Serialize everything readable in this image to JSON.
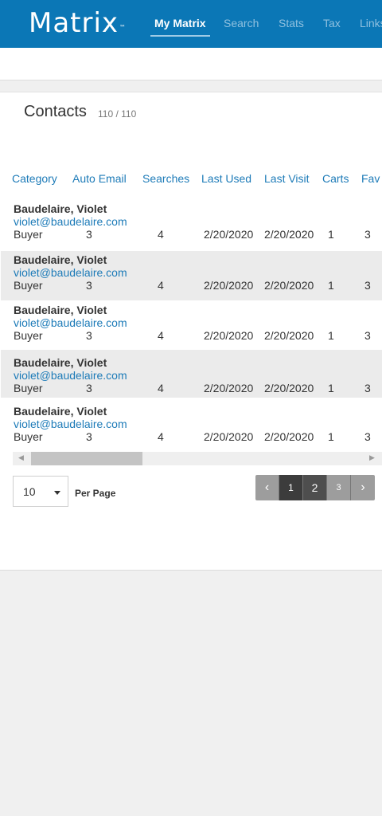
{
  "app": {
    "logo": "Matrix",
    "logo_tm": "™",
    "nav": [
      {
        "label": "My Matrix",
        "active": true
      },
      {
        "label": "Search"
      },
      {
        "label": "Stats"
      },
      {
        "label": "Tax"
      },
      {
        "label": "Links"
      }
    ]
  },
  "contacts": {
    "title": "Contacts",
    "count": "110 / 110",
    "columns": [
      "Category",
      "Auto Email",
      "Searches",
      "Last Used",
      "Last Visit",
      "Carts",
      "Fav"
    ],
    "rows": [
      {
        "name": "Baudelaire, Violet",
        "email": "violet@baudelaire.com",
        "category": "Buyer",
        "auto_email": "3",
        "searches": "4",
        "last_used": "2/20/2020",
        "last_visit": "2/20/2020",
        "carts": "1",
        "fav": "3"
      },
      {
        "name": "Baudelaire, Violet",
        "email": "violet@baudelaire.com",
        "category": "Buyer",
        "auto_email": "3",
        "searches": "4",
        "last_used": "2/20/2020",
        "last_visit": "2/20/2020",
        "carts": "1",
        "fav": "3"
      },
      {
        "name": "Baudelaire, Violet",
        "email": "violet@baudelaire.com",
        "category": "Buyer",
        "auto_email": "3",
        "searches": "4",
        "last_used": "2/20/2020",
        "last_visit": "2/20/2020",
        "carts": "1",
        "fav": "3"
      },
      {
        "name": "Baudelaire, Violet",
        "email": "violet@baudelaire.com",
        "category": "Buyer",
        "auto_email": "3",
        "searches": "4",
        "last_used": "2/20/2020",
        "last_visit": "2/20/2020",
        "carts": "1",
        "fav": "3"
      },
      {
        "name": "Baudelaire, Violet",
        "email": "violet@baudelaire.com",
        "category": "Buyer",
        "auto_email": "3",
        "searches": "4",
        "last_used": "2/20/2020",
        "last_visit": "2/20/2020",
        "carts": "1",
        "fav": "3"
      }
    ]
  },
  "scrollbar": {
    "left_icon": "scroll-left-arrow-icon",
    "right_icon": "scroll-right-arrow-icon",
    "left_glyph": "◀",
    "right_glyph": "▶"
  },
  "per_page": {
    "value": "10",
    "label": "Per Page"
  },
  "pagination": {
    "prev_glyph": "‹",
    "next_glyph": "›",
    "pages": [
      "1",
      "2",
      "3"
    ],
    "current": "2"
  },
  "colors": {
    "brand": "#0b77b6",
    "link": "#1d7bb8"
  }
}
